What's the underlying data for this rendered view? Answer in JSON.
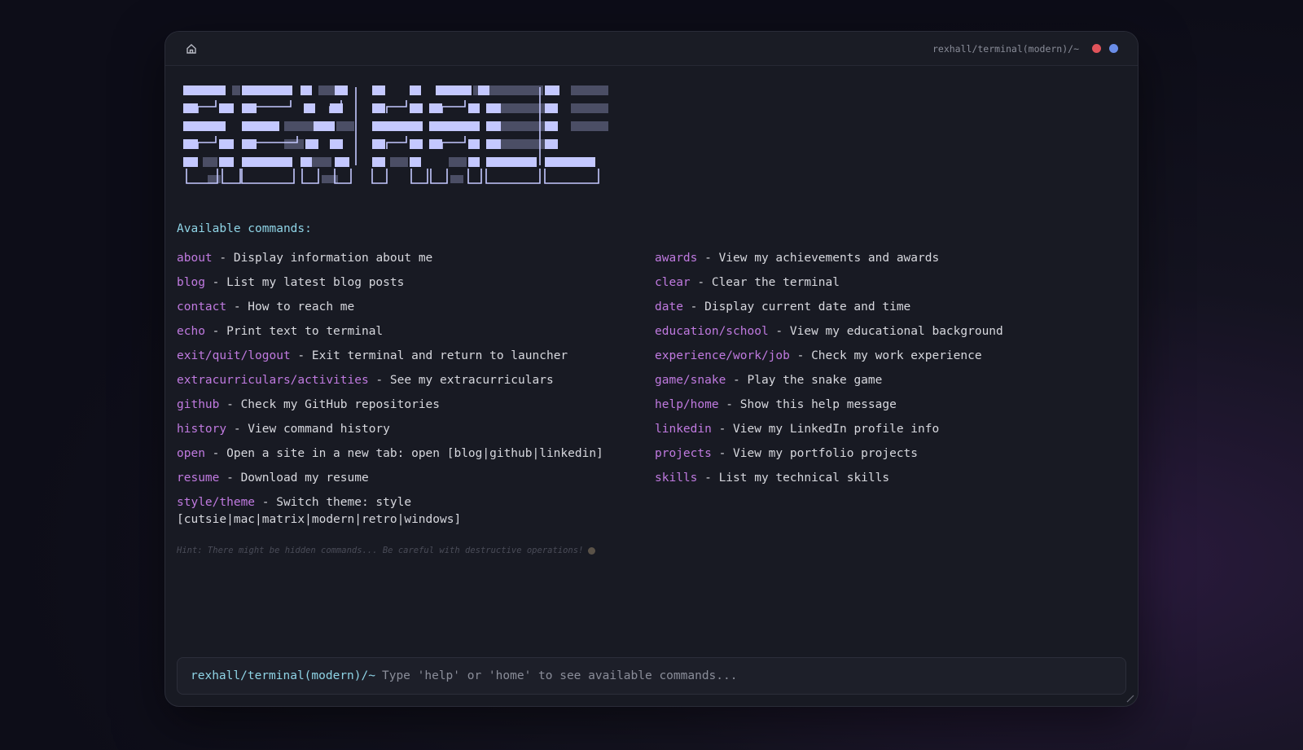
{
  "window": {
    "title_path": "rexhall/terminal(modern)/~",
    "controls": [
      {
        "name": "close",
        "color": "#e0535a"
      },
      {
        "name": "maximize",
        "color": "#6a8de8"
      }
    ]
  },
  "banner": {
    "description_icon": "ascii-art-logo",
    "color": "#c4c8ff"
  },
  "help": {
    "heading": "Available commands:",
    "left": [
      {
        "name": "about",
        "desc": " - Display information about me"
      },
      {
        "name": "blog",
        "desc": " - List my latest blog posts"
      },
      {
        "name": "contact",
        "desc": " - How to reach me"
      },
      {
        "name": "echo",
        "desc": " - Print text to terminal"
      },
      {
        "name": "exit/quit/logout",
        "desc": " - Exit terminal and return to launcher"
      },
      {
        "name": "extracurriculars/activities",
        "desc": " - See my extracurriculars"
      },
      {
        "name": "github",
        "desc": " - Check my GitHub repositories"
      },
      {
        "name": "history",
        "desc": " - View command history"
      },
      {
        "name": "open",
        "desc": " - Open a site in a new tab: open [blog|github|linkedin]"
      },
      {
        "name": "resume",
        "desc": " - Download my resume"
      },
      {
        "name": "style/theme",
        "desc": " - Switch theme: style\n[cutsie|mac|matrix|modern|retro|windows]"
      }
    ],
    "right": [
      {
        "name": "awards",
        "desc": " - View my achievements and awards"
      },
      {
        "name": "clear",
        "desc": " - Clear the terminal"
      },
      {
        "name": "date",
        "desc": " - Display current date and time"
      },
      {
        "name": "education/school",
        "desc": " - View my educational background"
      },
      {
        "name": "experience/work/job",
        "desc": " - Check my work experience"
      },
      {
        "name": "game/snake",
        "desc": " - Play the snake game"
      },
      {
        "name": "help/home",
        "desc": " - Show this help message"
      },
      {
        "name": "linkedin",
        "desc": " - View my LinkedIn profile info"
      },
      {
        "name": "projects",
        "desc": " - View my portfolio projects"
      },
      {
        "name": "skills",
        "desc": " - List my technical skills"
      }
    ],
    "hint": "Hint: There might be hidden commands... Be careful with destructive operations!"
  },
  "input": {
    "prompt": "rexhall/terminal(modern)/~",
    "placeholder": "Type 'help' or 'home' to see available commands...",
    "value": ""
  }
}
